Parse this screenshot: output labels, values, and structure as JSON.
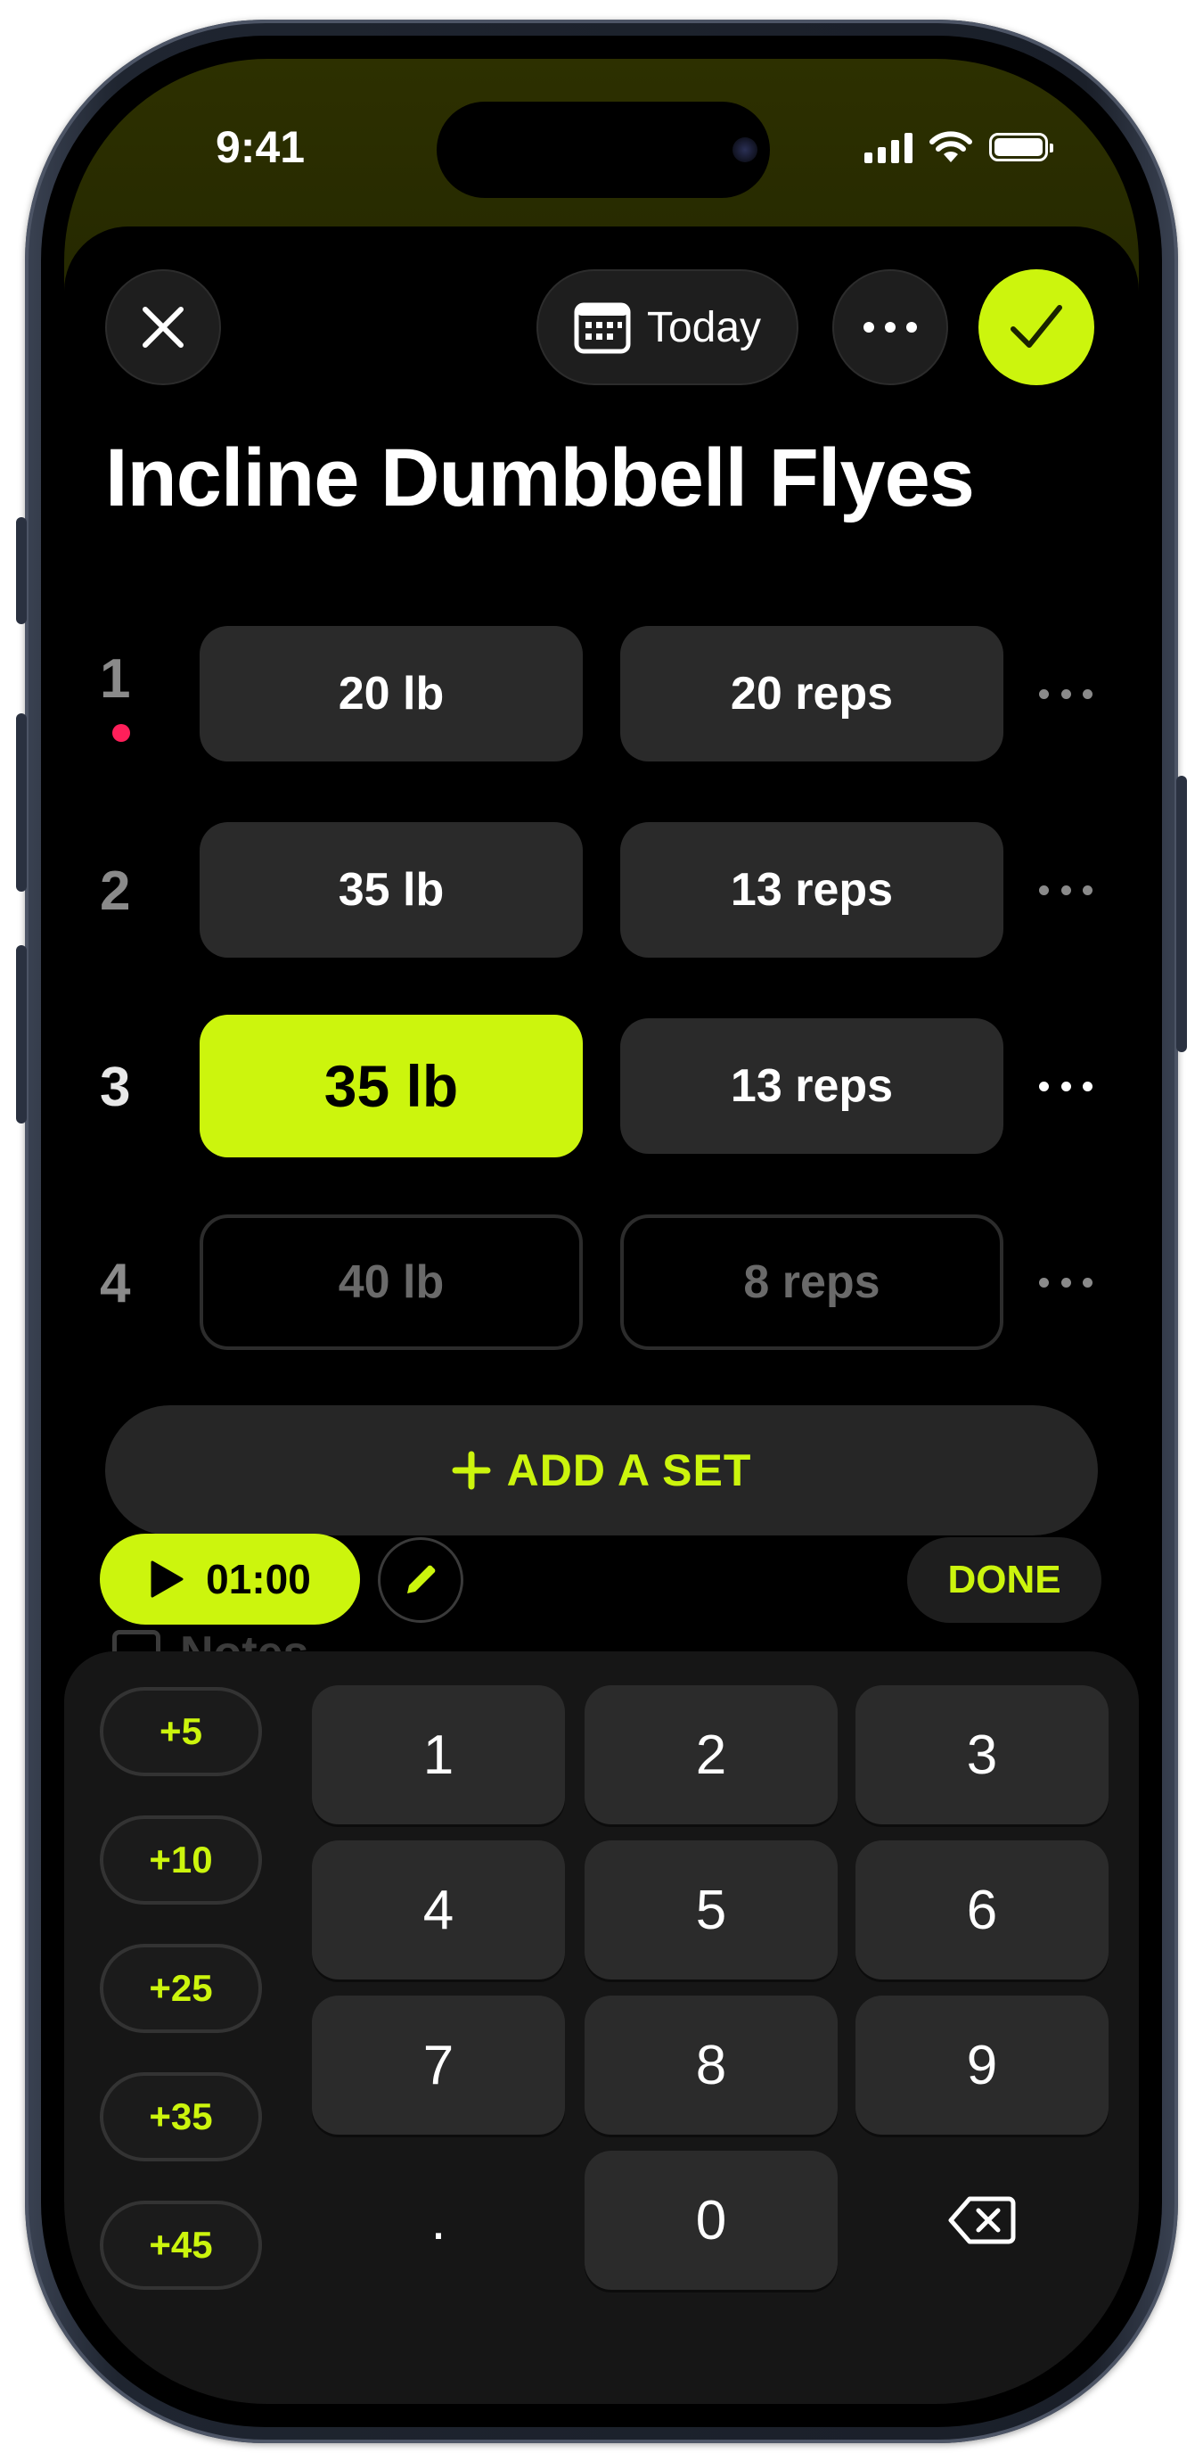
{
  "status_bar": {
    "time": "9:41"
  },
  "header": {
    "date_label": "Today"
  },
  "exercise": {
    "title": "Incline Dumbbell Flyes"
  },
  "sets": [
    {
      "number": "1",
      "weight": "20 lb",
      "reps": "20 reps",
      "marker": true
    },
    {
      "number": "2",
      "weight": "35 lb",
      "reps": "13 reps"
    },
    {
      "number": "3",
      "weight": "35 lb",
      "reps": "13 reps",
      "active": true
    },
    {
      "number": "4",
      "weight": "40 lb",
      "reps": "8 reps",
      "pending": true
    }
  ],
  "actions": {
    "add_set": "ADD A SET",
    "timer": "01:00",
    "done": "DONE",
    "notes": "Notes"
  },
  "keypad": {
    "increments": [
      "+5",
      "+10",
      "+25",
      "+35",
      "+45"
    ],
    "keys": [
      "1",
      "2",
      "3",
      "4",
      "5",
      "6",
      "7",
      "8",
      "9",
      ".",
      "0"
    ]
  },
  "colors": {
    "accent": "#ccf50d",
    "marker": "#ff1f5a",
    "background": "#000000",
    "cell": "#2a2a2a"
  },
  "icons": [
    "close-icon",
    "calendar-icon",
    "more-icon",
    "checkmark-icon",
    "plus-icon",
    "play-icon",
    "pencil-icon",
    "note-icon",
    "backspace-icon"
  ]
}
